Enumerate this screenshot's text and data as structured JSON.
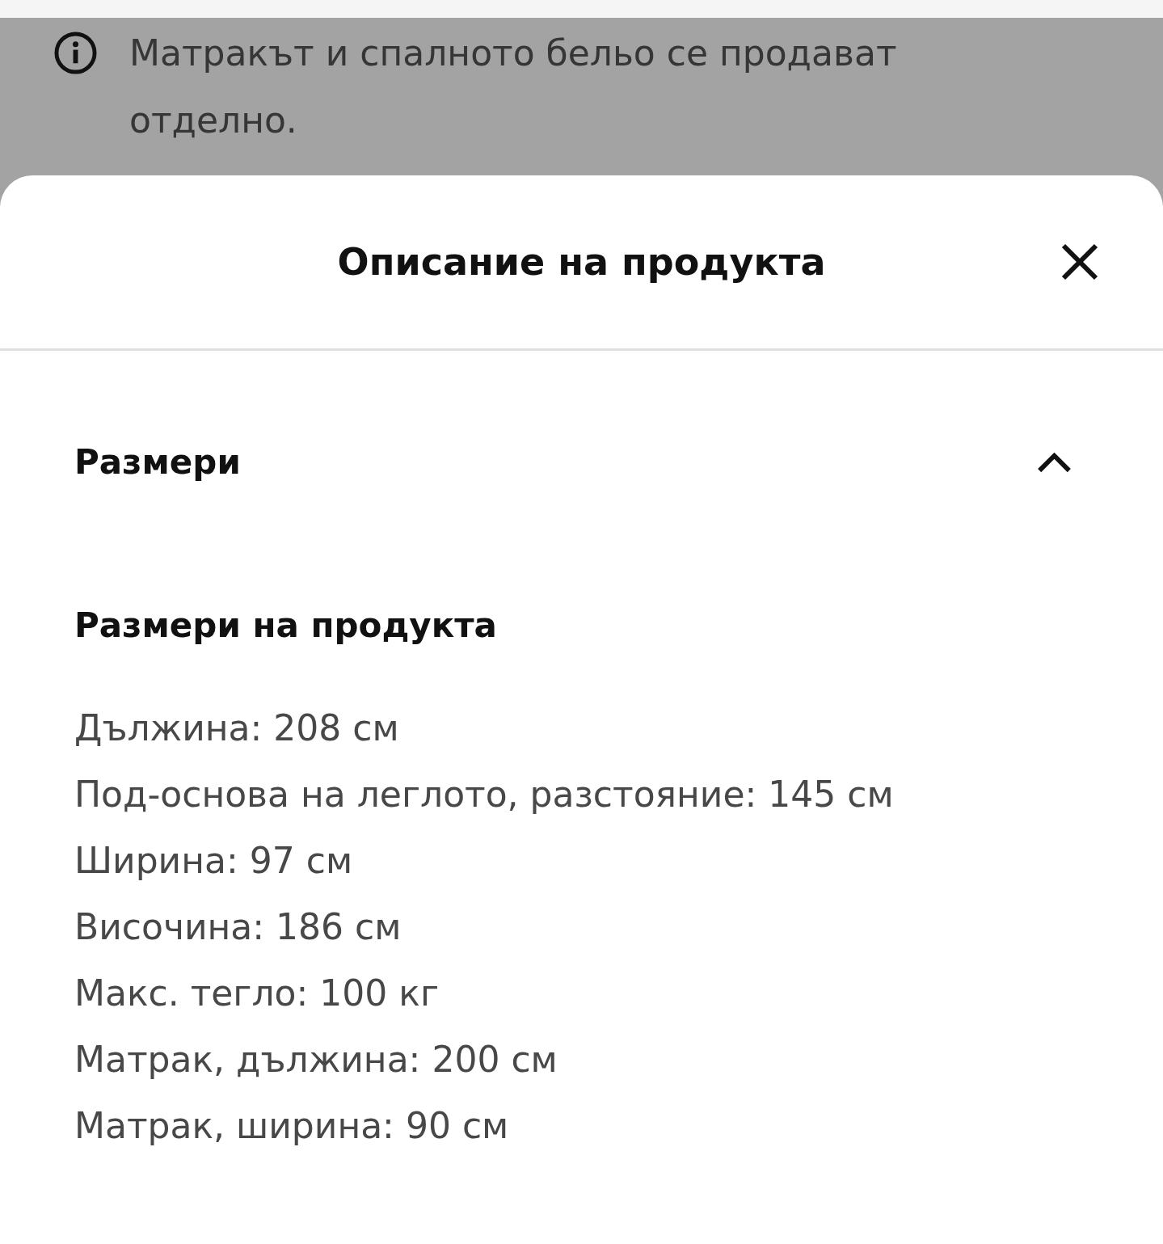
{
  "notice": {
    "text": "Матракът и спалното бельо се продават отделно."
  },
  "sheet": {
    "title": "Описание на продукта"
  },
  "sections": [
    {
      "title": "Размери",
      "expanded": true,
      "subheading": "Размери на продукта",
      "specs": [
        "Дължина: 208 см",
        "Под-основа на леглото, разстояние: 145 см",
        "Ширина: 97 см",
        "Височина: 186 см",
        "Макс. тегло: 100 кг",
        "Матрак, дължина: 200 см",
        "Матрак, ширина: 90 см"
      ]
    }
  ]
}
